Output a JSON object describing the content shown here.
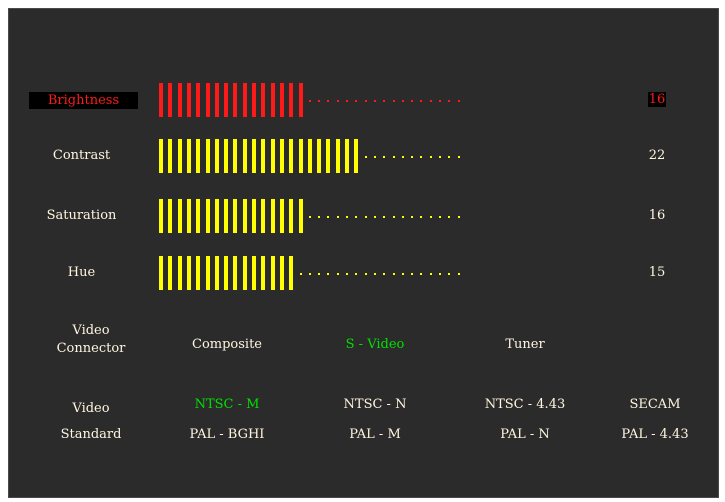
{
  "colors": {
    "selected": "#ff1a1a",
    "bar_normal": "#ffff00",
    "text": "#fff6e0",
    "highlight": "#00e000",
    "background": "#2b2b2b"
  },
  "adjustments": [
    {
      "label": "Brightness",
      "value": "16",
      "level": 16,
      "selected": true
    },
    {
      "label": "Contrast",
      "value": "22",
      "level": 22,
      "selected": false
    },
    {
      "label": "Saturation",
      "value": "16",
      "level": 16,
      "selected": false
    },
    {
      "label": "Hue",
      "value": "15",
      "level": 15,
      "selected": false
    }
  ],
  "max_level": 33,
  "video_connector": {
    "label_line1": "Video",
    "label_line2": "Connector",
    "options": [
      {
        "label": "Composite",
        "active": false
      },
      {
        "label": "S - Video",
        "active": true
      },
      {
        "label": "Tuner",
        "active": false
      }
    ]
  },
  "video_standard": {
    "label_line1": "Video",
    "label_line2": "Standard",
    "options": [
      {
        "line1": "NTSC - M",
        "line1_active": true,
        "line2": "PAL - BGHI"
      },
      {
        "line1": "NTSC - N",
        "line1_active": false,
        "line2": "PAL - M"
      },
      {
        "line1": "NTSC - 4.43",
        "line1_active": false,
        "line2": "PAL - N"
      },
      {
        "line1": "SECAM",
        "line1_active": false,
        "line2": "PAL - 4.43"
      }
    ]
  }
}
